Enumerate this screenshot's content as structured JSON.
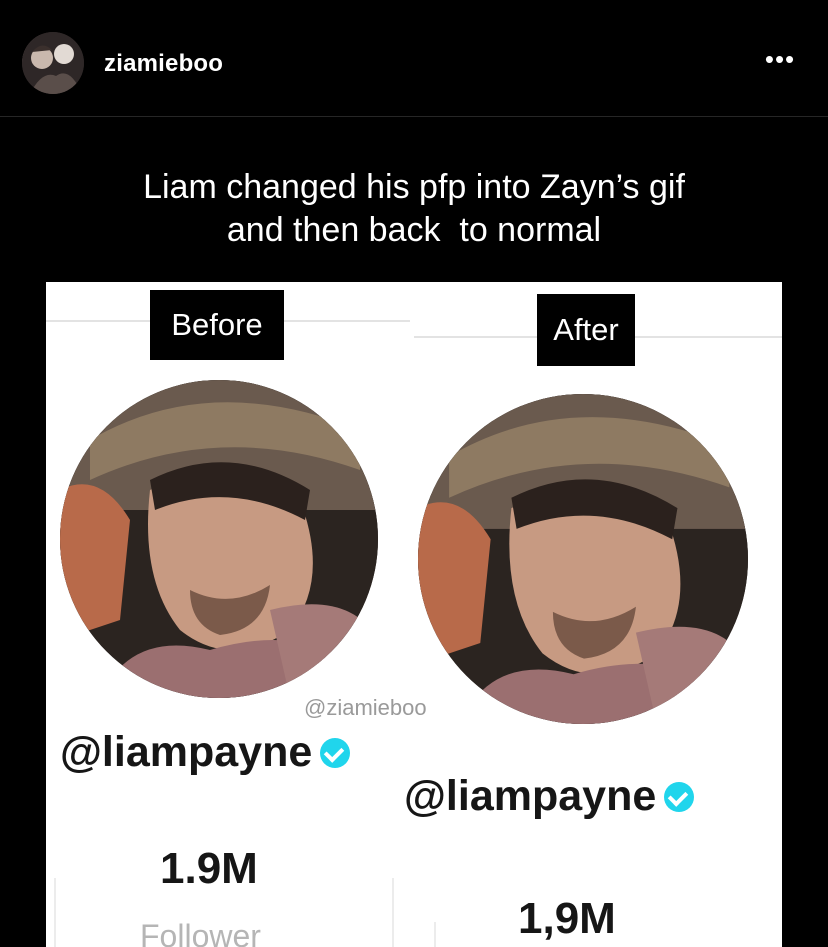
{
  "post": {
    "username": "ziamieboo",
    "more_icon": "more-horizontal-icon",
    "more_label": "•••"
  },
  "caption": {
    "line1": "Liam changed his pfp into Zayn’s gif",
    "line2": "and then back  to normal"
  },
  "panel": {
    "before_label": "Before",
    "after_label": "After",
    "watermark": "@ziamieboo",
    "before": {
      "handle": "@liampayne",
      "followers": "1.9M",
      "followers_label": "Follower"
    },
    "after": {
      "handle": "@liampayne",
      "followers": "1,9M"
    },
    "verified_color": "#20d5ec"
  }
}
